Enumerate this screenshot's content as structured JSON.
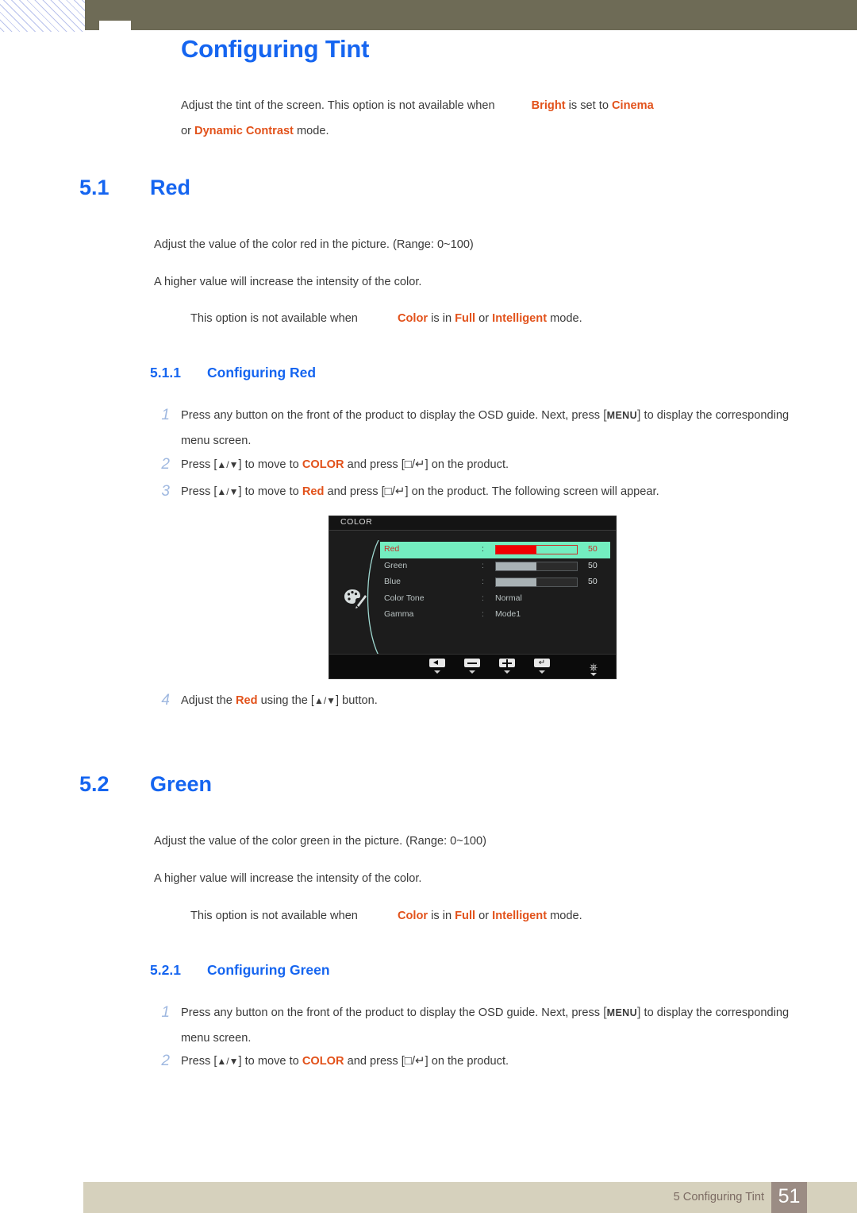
{
  "header": {
    "hatch_color": "#b9c2ec",
    "bar_color": "#6e6b56"
  },
  "page_title": "Configuring Tint",
  "accent_color": "#1565f0",
  "highlight_color": "#e2521b",
  "intro": {
    "line1_a": "Adjust the tint of the screen. This option is not available when",
    "line1_b": "Bright",
    "line1_c": " is set to ",
    "line1_d": "Cinema",
    "line2_a": "or ",
    "line2_b": "Dynamic Contrast",
    "line2_c": " mode."
  },
  "sections": [
    {
      "number": "5.1",
      "title": "Red",
      "desc_line1": "Adjust the value of the color red in the picture. (Range: 0~100)",
      "desc_line2": "A higher value will increase the intensity of the color.",
      "note_a": "This option is not available when",
      "note_color": "Color",
      "note_b": " is in ",
      "note_full": "Full",
      "note_c": " or ",
      "note_intelligent": "Intelligent",
      "note_d": " mode.",
      "sub_number": "5.1.1",
      "sub_title": "Configuring Red",
      "steps": [
        {
          "num": "1",
          "part1": "Press any button on the front of the product to display the OSD guide. Next, press ",
          "key": "MENU",
          "part2": " to display the corresponding menu screen."
        },
        {
          "num": "2",
          "part1": "Press [",
          "arrows": "▲/▼",
          "part2": "] to move to ",
          "target": "COLOR",
          "part3": " and press [",
          "keys2": "□/↵",
          "part4": "] on the product."
        },
        {
          "num": "3",
          "part1": "Press [",
          "arrows": "▲/▼",
          "part2": "] to move to ",
          "target": "Red",
          "part3": " and press [",
          "keys2": "□/↵",
          "part4": "] on the product. The following screen will appear."
        },
        {
          "num": "4",
          "part1": "Adjust the ",
          "target": "Red",
          "part2": " using the [",
          "arrows": "▲/▼",
          "part3": "] button."
        }
      ]
    },
    {
      "number": "5.2",
      "title": "Green",
      "desc_line1": "Adjust the value of the color green in the picture. (Range: 0~100)",
      "desc_line2": "A higher value will increase the intensity of the color.",
      "note_a": "This option is not available when",
      "note_color": "Color",
      "note_b": " is in ",
      "note_full": "Full",
      "note_c": " or ",
      "note_intelligent": "Intelligent",
      "note_d": " mode.",
      "sub_number": "5.2.1",
      "sub_title": "Configuring Green",
      "steps": [
        {
          "num": "1",
          "part1": "Press any button on the front of the product to display the OSD guide. Next, press ",
          "key": "MENU",
          "part2": " to display the corresponding menu screen."
        },
        {
          "num": "2",
          "part1": "Press [",
          "arrows": "▲/▼",
          "part2": "] to move to ",
          "target": "COLOR",
          "part3": " and press [",
          "keys2": "□/↵",
          "part4": "] on the product."
        }
      ]
    }
  ],
  "osd": {
    "title": "COLOR",
    "icon": "palette-icon",
    "rows": [
      {
        "label": "Red",
        "type": "slider",
        "value": "50",
        "fill_pct": 50,
        "active": true
      },
      {
        "label": "Green",
        "type": "slider",
        "value": "50",
        "fill_pct": 50,
        "active": false
      },
      {
        "label": "Blue",
        "type": "slider",
        "value": "50",
        "fill_pct": 50,
        "active": false
      },
      {
        "label": "Color Tone",
        "type": "text",
        "value": "Normal",
        "active": false
      },
      {
        "label": "Gamma",
        "type": "text",
        "value": "Mode1",
        "active": false
      }
    ],
    "buttons": [
      {
        "icon": "left-arrow-icon"
      },
      {
        "icon": "minus-icon"
      },
      {
        "icon": "plus-icon"
      },
      {
        "icon": "enter-icon"
      },
      {
        "icon": "power-icon"
      }
    ],
    "highlight_bg": "#73eec0",
    "highlight_fg": "#c8322a"
  },
  "footer": {
    "text": "5 Configuring Tint",
    "page": "51",
    "band_color": "#d6d1bd",
    "page_box_color": "#9b8c84"
  }
}
